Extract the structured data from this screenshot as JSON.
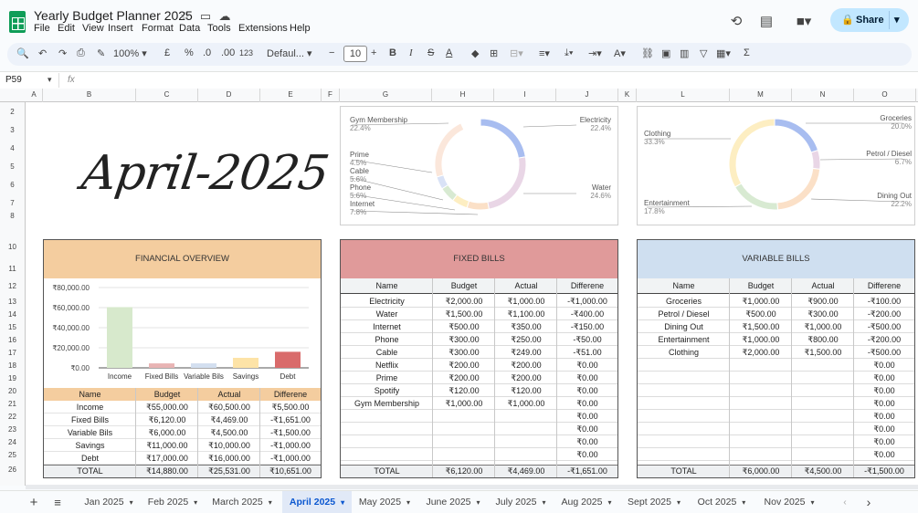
{
  "app": {
    "title": "Yearly Budget Planner 2025",
    "menus": [
      "File",
      "Edit",
      "View",
      "Insert",
      "Format",
      "Data",
      "Tools",
      "Extensions",
      "Help"
    ],
    "share": "Share"
  },
  "toolbar": {
    "zoom": "100%",
    "currency": "£",
    "percent": "%",
    "dec_less": ".0",
    "dec_more": ".00",
    "number_format": "123",
    "font": "Defaul...",
    "font_size": "10"
  },
  "formula_bar": {
    "cell_ref": "P59",
    "fx": "fx"
  },
  "columns": [
    "A",
    "B",
    "C",
    "D",
    "E",
    "F",
    "G",
    "H",
    "I",
    "J",
    "K",
    "L",
    "M",
    "N",
    "O"
  ],
  "rows": [
    "2",
    "3",
    "4",
    "5",
    "6",
    "7",
    "8",
    "10",
    "11",
    "12",
    "13",
    "14",
    "15",
    "16",
    "17",
    "18",
    "19",
    "20",
    "21",
    "22",
    "23",
    "24",
    "25",
    "26"
  ],
  "month_title": "April-2025",
  "fixed_donut": {
    "segments": [
      {
        "label": "Electricity",
        "pct": "22.4%",
        "color": "#a8bdf0"
      },
      {
        "label": "Water",
        "pct": "24.6%",
        "color": "#e9d6e6"
      },
      {
        "label": "Internet",
        "pct": "7.8%",
        "color": "#fbe0c7"
      },
      {
        "label": "Phone",
        "pct": "5.6%",
        "color": "#fdeec2"
      },
      {
        "label": "Cable",
        "pct": "5.6%",
        "color": "#d8ead2"
      },
      {
        "label": "Prime",
        "pct": "4.5%",
        "color": "#d9e2f6"
      },
      {
        "label": "Gym Membership",
        "pct": "22.4%",
        "color": "#fbe7db"
      }
    ]
  },
  "variable_donut": {
    "segments": [
      {
        "label": "Groceries",
        "pct": "20.0%",
        "color": "#a8bdf0"
      },
      {
        "label": "Petrol / Diesel",
        "pct": "6.7%",
        "color": "#e9d6e6"
      },
      {
        "label": "Dining Out",
        "pct": "22.2%",
        "color": "#fbe0c7"
      },
      {
        "label": "Entertainment",
        "pct": "17.8%",
        "color": "#d8ead2"
      },
      {
        "label": "Clothing",
        "pct": "33.3%",
        "color": "#fdeec2"
      }
    ]
  },
  "overview": {
    "title": "FINANCIAL OVERVIEW",
    "headers": [
      "Name",
      "Budget",
      "Actual",
      "Differene"
    ],
    "rows": [
      [
        "Income",
        "₹55,000.00",
        "₹60,500.00",
        "₹5,500.00"
      ],
      [
        "Fixed Bills",
        "₹6,120.00",
        "₹4,469.00",
        "-₹1,651.00"
      ],
      [
        "Variable Bils",
        "₹6,000.00",
        "₹4,500.00",
        "-₹1,500.00"
      ],
      [
        "Savings",
        "₹11,000.00",
        "₹10,000.00",
        "-₹1,000.00"
      ],
      [
        "Debt",
        "₹17,000.00",
        "₹16,000.00",
        "-₹1,000.00"
      ],
      [
        "TOTAL",
        "₹14,880.00",
        "₹25,531.00",
        "₹10,651.00"
      ]
    ]
  },
  "chart_data": {
    "type": "bar",
    "categories": [
      "Income",
      "Fixed Bills",
      "Variable Bils",
      "Savings",
      "Debt"
    ],
    "values": [
      60500,
      4469,
      4500,
      10000,
      16000
    ],
    "colors": [
      "#d7e9cc",
      "#e8b4b4",
      "#d3dff0",
      "#fde3a7",
      "#d96b6b"
    ],
    "y_ticks": [
      "₹0.00",
      "₹20,000.00",
      "₹40,000.00",
      "₹60,000.00",
      "₹80,000.00"
    ],
    "ylim": [
      0,
      80000
    ]
  },
  "fixed": {
    "title": "FIXED BILLS",
    "headers": [
      "Name",
      "Budget",
      "Actual",
      "Differene"
    ],
    "rows": [
      [
        "Electricity",
        "₹2,000.00",
        "₹1,000.00",
        "-₹1,000.00"
      ],
      [
        "Water",
        "₹1,500.00",
        "₹1,100.00",
        "-₹400.00"
      ],
      [
        "Internet",
        "₹500.00",
        "₹350.00",
        "-₹150.00"
      ],
      [
        "Phone",
        "₹300.00",
        "₹250.00",
        "-₹50.00"
      ],
      [
        "Cable",
        "₹300.00",
        "₹249.00",
        "-₹51.00"
      ],
      [
        "Netflix",
        "₹200.00",
        "₹200.00",
        "₹0.00"
      ],
      [
        "Prime",
        "₹200.00",
        "₹200.00",
        "₹0.00"
      ],
      [
        "Spotify",
        "₹120.00",
        "₹120.00",
        "₹0.00"
      ],
      [
        "Gym Membership",
        "₹1,000.00",
        "₹1,000.00",
        "₹0.00"
      ],
      [
        "",
        "",
        "",
        "₹0.00"
      ],
      [
        "",
        "",
        "",
        "₹0.00"
      ],
      [
        "",
        "",
        "",
        "₹0.00"
      ],
      [
        "",
        "",
        "",
        "₹0.00"
      ]
    ],
    "total": [
      "TOTAL",
      "₹6,120.00",
      "₹4,469.00",
      "-₹1,651.00"
    ]
  },
  "variable": {
    "title": "VARIABLE BILLS",
    "headers": [
      "Name",
      "Budget",
      "Actual",
      "Differene"
    ],
    "rows": [
      [
        "Groceries",
        "₹1,000.00",
        "₹900.00",
        "-₹100.00"
      ],
      [
        "Petrol / Diesel",
        "₹500.00",
        "₹300.00",
        "-₹200.00"
      ],
      [
        "Dining Out",
        "₹1,500.00",
        "₹1,000.00",
        "-₹500.00"
      ],
      [
        "Entertainment",
        "₹1,000.00",
        "₹800.00",
        "-₹200.00"
      ],
      [
        "Clothing",
        "₹2,000.00",
        "₹1,500.00",
        "-₹500.00"
      ],
      [
        "",
        "",
        "",
        "₹0.00"
      ],
      [
        "",
        "",
        "",
        "₹0.00"
      ],
      [
        "",
        "",
        "",
        "₹0.00"
      ],
      [
        "",
        "",
        "",
        "₹0.00"
      ],
      [
        "",
        "",
        "",
        "₹0.00"
      ],
      [
        "",
        "",
        "",
        "₹0.00"
      ],
      [
        "",
        "",
        "",
        "₹0.00"
      ],
      [
        "",
        "",
        "",
        "₹0.00"
      ]
    ],
    "total": [
      "TOTAL",
      "₹6,000.00",
      "₹4,500.00",
      "-₹1,500.00"
    ]
  },
  "tabs": [
    "Jan 2025",
    "Feb 2025",
    "March 2025",
    "April 2025",
    "May 2025",
    "June 2025",
    "July 2025",
    "Aug 2025",
    "Sept 2025",
    "Oct 2025",
    "Nov 2025"
  ],
  "active_tab": "April 2025",
  "colors": {
    "overview_header": "#f4cd9f",
    "fixed_header": "#e09a9a",
    "variable_header": "#cfdff0",
    "share_bg": "#c2e7ff"
  }
}
